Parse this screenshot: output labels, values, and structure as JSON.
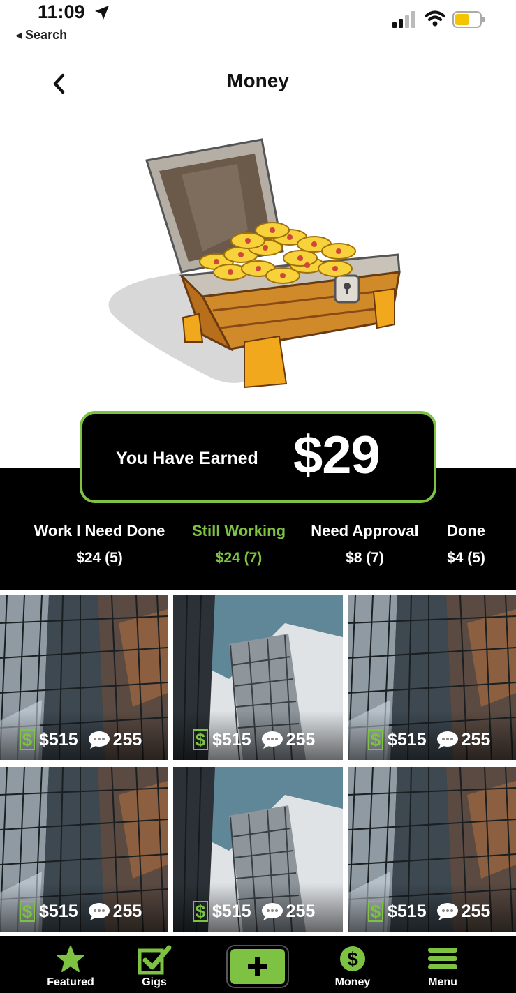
{
  "status_bar": {
    "time": "11:09",
    "back_app": "◂ Search"
  },
  "header": {
    "title": "Money"
  },
  "earned": {
    "label": "You Have Earned",
    "amount": "$29"
  },
  "tabs": [
    {
      "label": "Work I Need Done",
      "value": "$24 (5)",
      "active": false
    },
    {
      "label": "Still Working",
      "value": "$24 (7)",
      "active": true
    },
    {
      "label": "Need Approval",
      "value": "$8 (7)",
      "active": false
    },
    {
      "label": "Done",
      "value": "$4 (5)",
      "active": false
    }
  ],
  "tiles": [
    {
      "price": "$515",
      "comments": "255"
    },
    {
      "price": "$515",
      "comments": "255"
    },
    {
      "price": "$515",
      "comments": "255"
    },
    {
      "price": "$515",
      "comments": "255"
    },
    {
      "price": "$515",
      "comments": "255"
    },
    {
      "price": "$515",
      "comments": "255"
    }
  ],
  "nav": {
    "featured": "Featured",
    "gigs": "Gigs",
    "money": "Money",
    "menu": "Menu"
  },
  "colors": {
    "accent": "#7dc242",
    "background": "#000000",
    "text": "#ffffff"
  }
}
